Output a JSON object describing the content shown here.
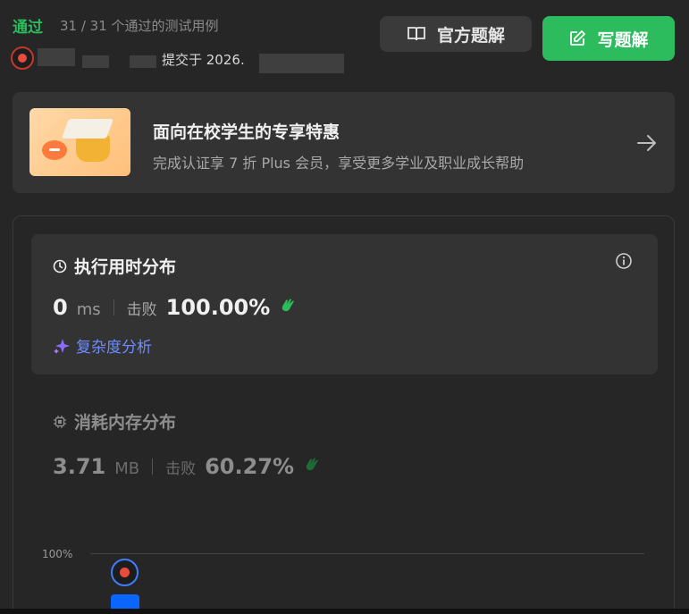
{
  "header": {
    "status": "通过",
    "tests": "31 / 31 个通过的测试用例",
    "submitted_prefix": "提交于 2026.",
    "btn_solution": "官方题解",
    "btn_write": "写题解"
  },
  "promo": {
    "title": "面向在校学生的专享特惠",
    "subtitle": "完成认证享 7 折 Plus 会员，享受更多学业及职业成长帮助"
  },
  "runtime": {
    "title": "执行用时分布",
    "value": "0",
    "unit": "ms",
    "beat_label": "击败",
    "beat_value": "100.00%",
    "analysis": "复杂度分析"
  },
  "memory": {
    "title": "消耗内存分布",
    "value": "3.71",
    "unit": "MB",
    "beat_label": "击败",
    "beat_value": "60.27%"
  },
  "chart": {
    "y_label": "100%"
  },
  "colors": {
    "accent_green": "#2cbb5d",
    "link_purple": "#6e8cff",
    "bar_blue": "#0a66ff"
  }
}
